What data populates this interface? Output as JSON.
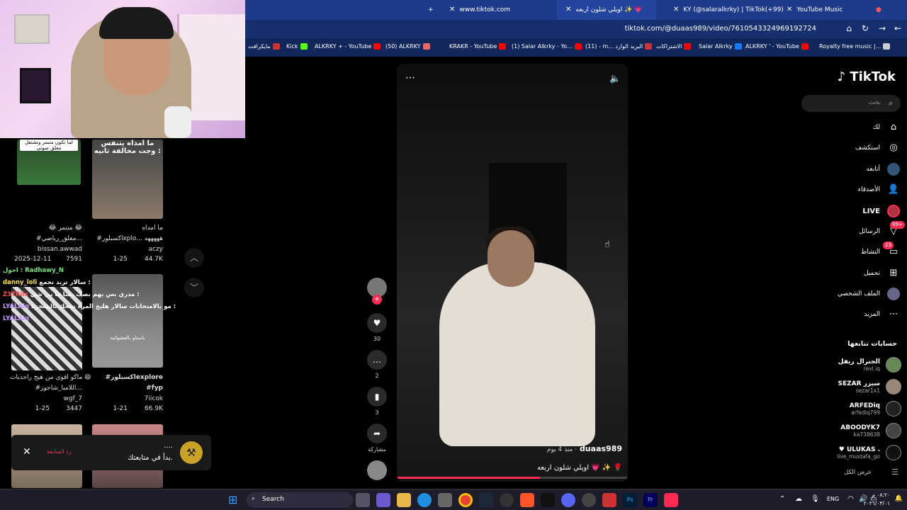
{
  "tabs": [
    {
      "label": "+"
    },
    {
      "label": "www.tiktok.com"
    },
    {
      "label": "اويلي شلون اربعه ✨ 💗"
    },
    {
      "label": "KY (@salaralkrky) | TikTok(+99)"
    },
    {
      "label": "YouTube Music"
    }
  ],
  "address": {
    "url": "tiktok.com/@duaas989/video/7610543324969192724"
  },
  "bookmarks": [
    "مايكرافت",
    "Kick",
    "ALKRKY + - YouTube",
    "(50) ALKRKY",
    "KRAKR - YouTube",
    "(1) Salar Alkrky - Yo...",
    "(11) - m... البريد الوارد",
    "الاشتراكات",
    "Salar Alkrky",
    "ALKRKY ' - YouTube",
    "Royalty free music |..."
  ],
  "left_videos": [
    {
      "overlay": "لما تكون متنمر وتشتغل معلق صوتي",
      "title": "😂 متنمر 😂",
      "subtitle": "#معلق_رياضي...",
      "user": "bissan.awwad",
      "date": "2025-12-11",
      "views": "7591"
    },
    {
      "overlay": "ما امداه يتنفس وجت مخالفة ثانيه :",
      "title": "ما امداه",
      "subtitle": "#اكسبلورxplo... هههههه",
      "user": "aczy",
      "date": "1-25",
      "views": "44.7K"
    },
    {
      "overlay": "",
      "title": "ماكو اقوى من هيج راجديات 😆",
      "subtitle": "#اللامبا_شاجور...",
      "user": "wgf_7",
      "date": "1-25",
      "views": "3447"
    },
    {
      "overlay": "باستاو بالعشوائية",
      "title": "#اكسبلورexplore",
      "subtitle": "#fyp",
      "user": "7iicok",
      "date": "1-21",
      "views": "66.9K"
    }
  ],
  "chat": [
    {
      "user": "Radhawy_N",
      "text": "احول :",
      "color": "#7fe07f"
    },
    {
      "user": "danny_loli",
      "text": "سالار تربد تجمع :",
      "color": "#ffe34d"
    },
    {
      "user": "Z3TRiix",
      "text": "مدري بس يهم بصب يمنا ما بي شي :",
      "color": "#ff4d4d"
    },
    {
      "user": "LYALAlq",
      "text": "مو بالامتحانات سالار هليج المرة تجحك بالمعجزة :",
      "color": "#c99cff"
    },
    {
      "user": "LYALAlq",
      "text": "",
      "color": "#c99cff"
    }
  ],
  "actions": {
    "likes": "30",
    "comments": "2",
    "saves": "3",
    "share": "مشاركة"
  },
  "video": {
    "username": "duaas989",
    "time": "منذ 4 يوم ·",
    "caption": "اويلي شلون اربعه 💗 ✨ 🌹",
    "progress": 0.62
  },
  "tiktok": {
    "logo": "TikTok",
    "search_placeholder": "بحث"
  },
  "nav": [
    {
      "label": "لك",
      "icon": "home-icon"
    },
    {
      "label": "استكشف",
      "icon": "compass-icon"
    },
    {
      "label": "أتابعه",
      "icon": "following-icon"
    },
    {
      "label": "الأصدقاء",
      "icon": "friends-icon"
    },
    {
      "label": "LIVE",
      "icon": "live-icon"
    },
    {
      "label": "الرسائل",
      "icon": "messages-icon",
      "badge": "99+"
    },
    {
      "label": "النشاط",
      "icon": "activity-icon",
      "badge": "23"
    },
    {
      "label": "تحميل",
      "icon": "upload-icon"
    },
    {
      "label": "الملف الشخصي",
      "icon": "profile-icon"
    },
    {
      "label": "المزيد",
      "icon": "more-icon"
    }
  ],
  "following_title": "حسابات تتابعها",
  "following": [
    {
      "name": "الجنرال ريفل",
      "handle": "revl.iq"
    },
    {
      "name": "SEZAR سيزر",
      "handle": "sezar1x1"
    },
    {
      "name": "ARFEDiq",
      "handle": "arfediq799"
    },
    {
      "name": "ABOODYK7",
      "handle": "ka738638"
    },
    {
      "name": "♥ ULUKAS .",
      "handle": "live_mustafa_go"
    }
  ],
  "see_all": "عرض الكل",
  "notification": {
    "title": "بدأ في متابعتك.",
    "dots": "....",
    "action": "رد المتابعة"
  },
  "taskbar": {
    "search": "Search",
    "lang": "ENG",
    "time": "٠٨:٢٠ م",
    "date": "٢٠٢٦/٠٣/٠١"
  }
}
